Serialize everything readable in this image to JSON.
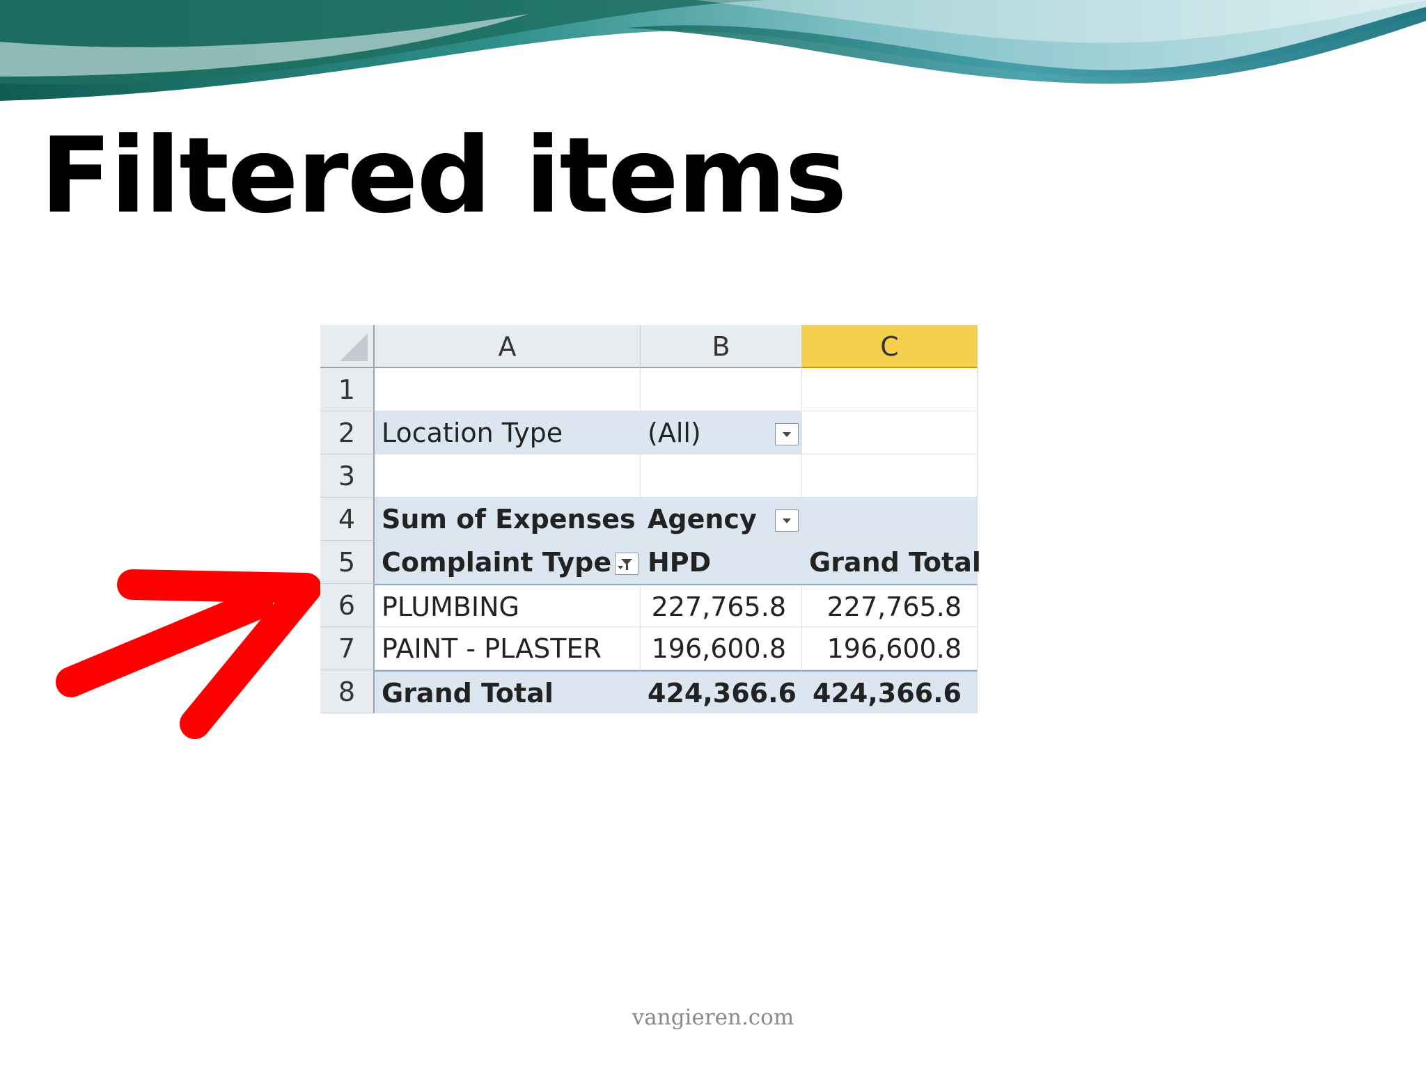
{
  "slide": {
    "title": "Filtered items",
    "footer": "vangieren.com"
  },
  "banner": {
    "colors": [
      "#0f5c52",
      "#2f8f9a",
      "#9fd0d8"
    ]
  },
  "arrow": {
    "color": "#ff0000",
    "icon": "red-arrow-icon",
    "points_to_row": "6"
  },
  "spreadsheet": {
    "columns": [
      "A",
      "B",
      "C"
    ],
    "selected_column": "C",
    "row_numbers": [
      "1",
      "2",
      "3",
      "4",
      "5",
      "6",
      "7",
      "8"
    ],
    "filter": {
      "label": "Location Type",
      "value": "(All)"
    },
    "pivot": {
      "value_field": "Sum of Expenses",
      "column_field": "Agency",
      "row_field": "Complaint Type",
      "col_item": "HPD",
      "grand_total_label": "Grand Total",
      "rows": [
        {
          "label": "PLUMBING",
          "hpd": "227,765.8",
          "total": "227,765.8"
        },
        {
          "label": "PAINT - PLASTER",
          "hpd": "196,600.8",
          "total": "196,600.8"
        }
      ],
      "grand_total": {
        "label": "Grand Total",
        "hpd": "424,366.6",
        "total": "424,366.6"
      }
    },
    "colors": {
      "header_fill": "#dce6f1",
      "selected_col": "#f5cf4e"
    }
  }
}
